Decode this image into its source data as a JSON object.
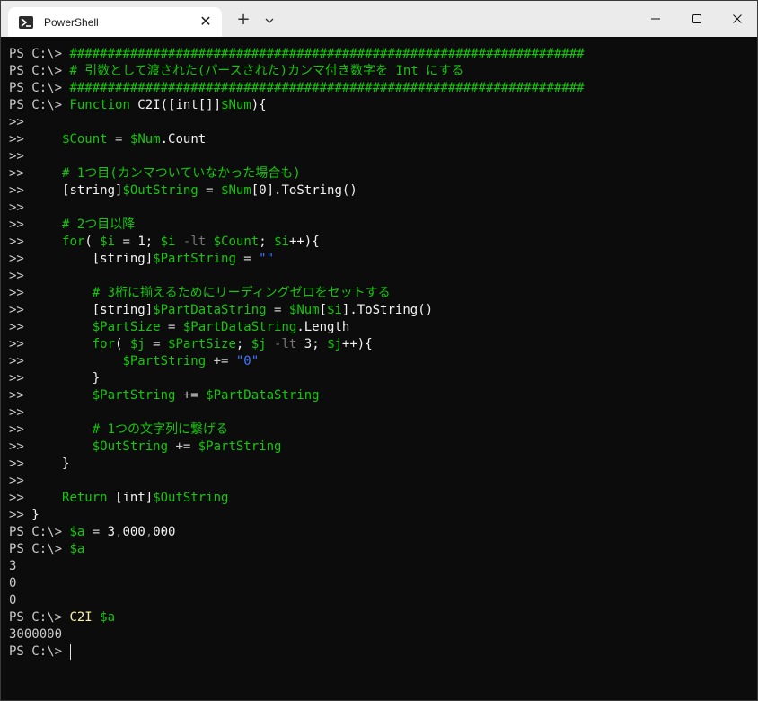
{
  "window": {
    "tab_title": "PowerShell",
    "tab_icon": "powershell-icon",
    "close_tab_glyph": "✕",
    "new_tab_glyph": "+"
  },
  "colors": {
    "background": "#0c0c0c",
    "default_text": "#cccccc",
    "command": "#16c60c",
    "number": "#f2f2f2",
    "string": "#3b78ff",
    "function_call": "#f9f1a5",
    "operator": "#767676"
  },
  "terminal": {
    "lines": [
      [
        [
          "d",
          "PS C:\\> "
        ],
        [
          "g",
          "####################################################################"
        ]
      ],
      [
        [
          "d",
          "PS C:\\> "
        ],
        [
          "g",
          "# 引数として渡された(パースされた)カンマ付き数字を Int にする"
        ]
      ],
      [
        [
          "d",
          "PS C:\\> "
        ],
        [
          "g",
          "####################################################################"
        ]
      ],
      [
        [
          "d",
          "PS C:\\> "
        ],
        [
          "g",
          "Function "
        ],
        [
          "w",
          "C2I([int[]]"
        ],
        [
          "g",
          "$Num"
        ],
        [
          "w",
          "){"
        ]
      ],
      [
        [
          "d",
          ">>"
        ]
      ],
      [
        [
          "d",
          ">>     "
        ],
        [
          "g",
          "$Count"
        ],
        [
          "d",
          " = "
        ],
        [
          "g",
          "$Num"
        ],
        [
          "w",
          ".Count"
        ]
      ],
      [
        [
          "d",
          ">>"
        ]
      ],
      [
        [
          "d",
          ">>     "
        ],
        [
          "g",
          "# 1つ目(カンマついていなかった場合も)"
        ]
      ],
      [
        [
          "d",
          ">>     "
        ],
        [
          "w",
          "[string]"
        ],
        [
          "g",
          "$OutString"
        ],
        [
          "d",
          " = "
        ],
        [
          "g",
          "$Num"
        ],
        [
          "w",
          "[0].ToString()"
        ]
      ],
      [
        [
          "d",
          ">>"
        ]
      ],
      [
        [
          "d",
          ">>     "
        ],
        [
          "g",
          "# 2つ目以降"
        ]
      ],
      [
        [
          "d",
          ">>     "
        ],
        [
          "g",
          "for"
        ],
        [
          "w",
          "( "
        ],
        [
          "g",
          "$i"
        ],
        [
          "d",
          " = "
        ],
        [
          "w",
          "1; "
        ],
        [
          "g",
          "$i"
        ],
        [
          "gr",
          " -lt "
        ],
        [
          "g",
          "$Count"
        ],
        [
          "w",
          "; "
        ],
        [
          "g",
          "$i"
        ],
        [
          "w",
          "++){"
        ]
      ],
      [
        [
          "d",
          ">>         "
        ],
        [
          "w",
          "[string]"
        ],
        [
          "g",
          "$PartString"
        ],
        [
          "d",
          " = "
        ],
        [
          "b",
          "\"\""
        ]
      ],
      [
        [
          "d",
          ">>"
        ]
      ],
      [
        [
          "d",
          ">>         "
        ],
        [
          "g",
          "# 3桁に揃えるためにリーディングゼロをセットする"
        ]
      ],
      [
        [
          "d",
          ">>         "
        ],
        [
          "w",
          "[string]"
        ],
        [
          "g",
          "$PartDataString"
        ],
        [
          "d",
          " = "
        ],
        [
          "g",
          "$Num"
        ],
        [
          "w",
          "["
        ],
        [
          "g",
          "$i"
        ],
        [
          "w",
          "].ToString()"
        ]
      ],
      [
        [
          "d",
          ">>         "
        ],
        [
          "g",
          "$PartSize"
        ],
        [
          "d",
          " = "
        ],
        [
          "g",
          "$PartDataString"
        ],
        [
          "w",
          ".Length"
        ]
      ],
      [
        [
          "d",
          ">>         "
        ],
        [
          "g",
          "for"
        ],
        [
          "w",
          "( "
        ],
        [
          "g",
          "$j"
        ],
        [
          "d",
          " = "
        ],
        [
          "g",
          "$PartSize"
        ],
        [
          "w",
          "; "
        ],
        [
          "g",
          "$j"
        ],
        [
          "gr",
          " -lt "
        ],
        [
          "w",
          "3; "
        ],
        [
          "g",
          "$j"
        ],
        [
          "w",
          "++){"
        ]
      ],
      [
        [
          "d",
          ">>             "
        ],
        [
          "g",
          "$PartString"
        ],
        [
          "d",
          " += "
        ],
        [
          "b",
          "\"0\""
        ]
      ],
      [
        [
          "d",
          ">>         "
        ],
        [
          "w",
          "}"
        ]
      ],
      [
        [
          "d",
          ">>         "
        ],
        [
          "g",
          "$PartString"
        ],
        [
          "d",
          " += "
        ],
        [
          "g",
          "$PartDataString"
        ]
      ],
      [
        [
          "d",
          ">>"
        ]
      ],
      [
        [
          "d",
          ">>         "
        ],
        [
          "g",
          "# 1つの文字列に繋げる"
        ]
      ],
      [
        [
          "d",
          ">>         "
        ],
        [
          "g",
          "$OutString"
        ],
        [
          "d",
          " += "
        ],
        [
          "g",
          "$PartString"
        ]
      ],
      [
        [
          "d",
          ">>     "
        ],
        [
          "w",
          "}"
        ]
      ],
      [
        [
          "d",
          ">>"
        ]
      ],
      [
        [
          "d",
          ">>     "
        ],
        [
          "g",
          "Return "
        ],
        [
          "w",
          "[int]"
        ],
        [
          "g",
          "$OutString"
        ]
      ],
      [
        [
          "d",
          ">> "
        ],
        [
          "w",
          "}"
        ]
      ],
      [
        [
          "d",
          "PS C:\\> "
        ],
        [
          "g",
          "$a"
        ],
        [
          "d",
          " = "
        ],
        [
          "w",
          "3"
        ],
        [
          "gr",
          ","
        ],
        [
          "w",
          "000"
        ],
        [
          "gr",
          ","
        ],
        [
          "w",
          "000"
        ]
      ],
      [
        [
          "d",
          "PS C:\\> "
        ],
        [
          "g",
          "$a"
        ]
      ],
      [
        [
          "d",
          "3"
        ]
      ],
      [
        [
          "d",
          "0"
        ]
      ],
      [
        [
          "d",
          "0"
        ]
      ],
      [
        [
          "d",
          "PS C:\\> "
        ],
        [
          "y",
          "C2I "
        ],
        [
          "g",
          "$a"
        ]
      ],
      [
        [
          "d",
          "3000000"
        ]
      ],
      [
        [
          "d",
          "PS C:\\> "
        ]
      ]
    ]
  }
}
